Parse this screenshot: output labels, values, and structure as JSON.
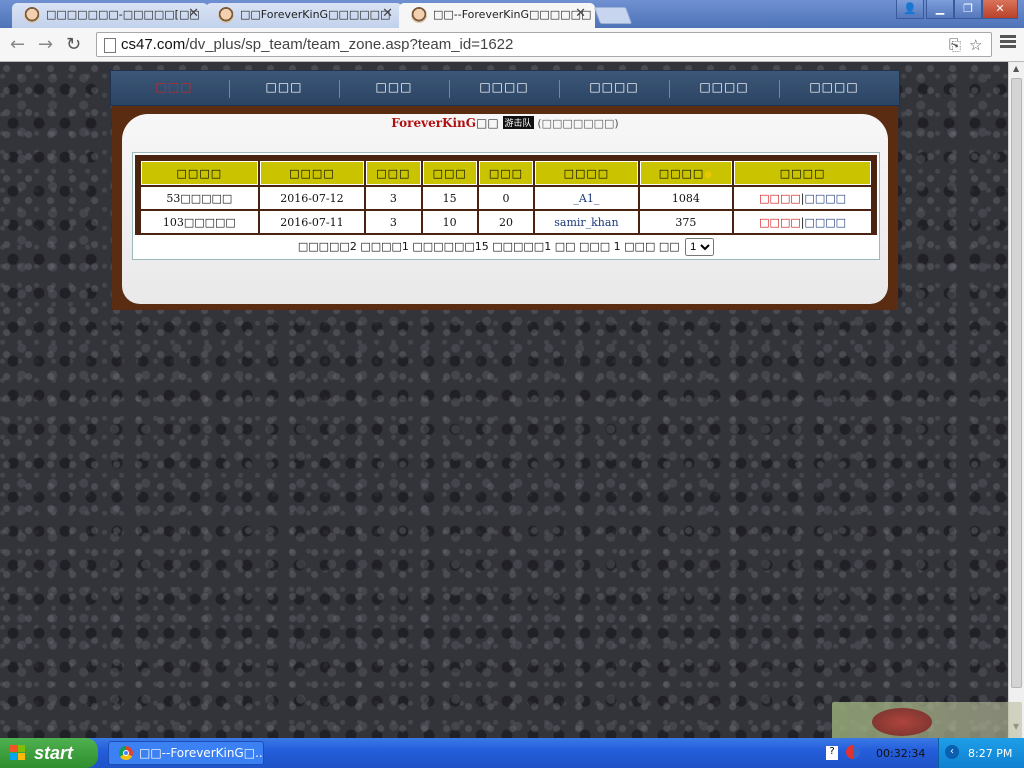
{
  "browser": {
    "tabs": [
      {
        "title": "□□□□□□□-□□□□□[□□"
      },
      {
        "title": "□□ForeverKinG□□□□□□"
      },
      {
        "title": "□□--ForeverKinG□□□□□□",
        "active": true
      }
    ],
    "url_host": "cs47.com",
    "url_path": "/dv_plus/sp_team/team_zone.asp?team_id=1622"
  },
  "site_nav": {
    "items": [
      {
        "label": "□□□",
        "logo": true
      },
      {
        "label": "□□□"
      },
      {
        "label": "□□□"
      },
      {
        "label": "□□□□"
      },
      {
        "label": "□□□□"
      },
      {
        "label": "□□□□"
      },
      {
        "label": "□□□□"
      }
    ]
  },
  "panel": {
    "team_name": "ForeverKinG",
    "name_suffix": "□□",
    "badge": "游击队",
    "note": "(□□□□□□□)"
  },
  "records": {
    "columns": [
      "□□□□",
      "□□□□",
      "□□□",
      "□□□",
      "□□□",
      "□□□□",
      "□□□□",
      "□□□□"
    ],
    "rows": [
      {
        "match": "53□□□□□",
        "date": "2016-07-12",
        "c3": "3",
        "c4": "15",
        "c5": "0",
        "player": "_A1_",
        "score": "1084",
        "op_view": "□□□□",
        "op_sep": "|",
        "op_edit": "□□□□"
      },
      {
        "match": "103□□□□□",
        "date": "2016-07-11",
        "c3": "3",
        "c4": "10",
        "c5": "20",
        "player": "samir_khan",
        "score": "375",
        "op_view": "□□□□",
        "op_sep": "|",
        "op_edit": "□□□□"
      }
    ],
    "pager_text": "□□□□□2 □□□□1 □□□□□□15 □□□□□1 □□ □□□ 1 □□□ □□",
    "page_select": "1"
  },
  "taskbar": {
    "start_label": "start",
    "task_label": "□□--ForeverKinG□...",
    "timer": "00:32:34",
    "clock": "8:27 PM"
  },
  "colors": {
    "nav_bg": "#2b4464",
    "frame_brown": "#5a2c12",
    "header_yellow": "#c9c300",
    "team_red": "#b01010"
  }
}
